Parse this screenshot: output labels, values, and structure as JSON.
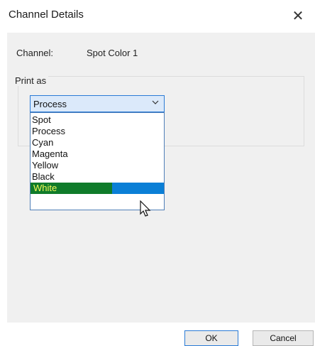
{
  "window": {
    "title": "Channel Details",
    "close_symbol": "✕"
  },
  "channel": {
    "label": "Channel:",
    "value": "Spot Color 1"
  },
  "print_as": {
    "group_label": "Print as",
    "selected": "Process",
    "options": [
      "Spot",
      "Process",
      "Cyan",
      "Magenta",
      "Yellow",
      "Black",
      "White"
    ],
    "highlighted": "White"
  },
  "buttons": {
    "ok": "OK",
    "cancel": "Cancel"
  },
  "colors": {
    "highlight_blue": "#0a7fd6",
    "highlight_green": "#0f7b2a",
    "highlight_text_yellow": "#f3f95a"
  },
  "icons": {
    "close": "close-icon",
    "dropdown": "chevron-down-icon",
    "cursor": "mouse-pointer-icon"
  }
}
